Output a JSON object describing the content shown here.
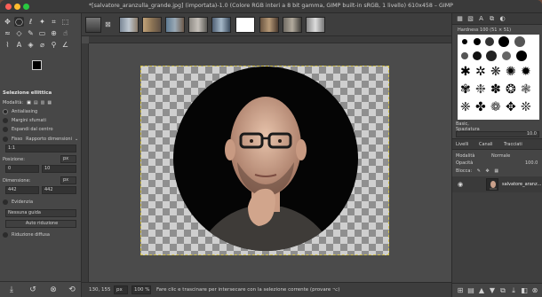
{
  "window": {
    "title": "*[salvatore_aranzulla_grande.jpg] (importata)-1.0 (Colore RGB interi a 8 bit gamma, GIMP built-in sRGB, 1 livello) 610x458 – GIMP"
  },
  "toolbox": {
    "options_title": "Selezione ellittica",
    "mode_label": "Modalità:",
    "antialiasing_label": "Antialiasing",
    "feather_label": "Margini sfumati",
    "expand_label": "Espandi dal centro",
    "fixed_label": "Fisso",
    "fixed_option": "Rapporto dimensioni",
    "ratio_value": "1:1",
    "position_label": "Posizione:",
    "position_unit": "px",
    "position_x": "0",
    "position_y": "10",
    "size_label": "Dimensione:",
    "size_unit": "px",
    "size_w": "442",
    "size_h": "442",
    "highlight_label": "Evidenzia",
    "guides_option": "Nessuna guida",
    "auto_shrink_label": "Auto riduzione",
    "shrink_merged_label": "Riduzione diffusa"
  },
  "statusbar": {
    "coords": "130, 155",
    "unit": "px",
    "zoom": "100 %",
    "message": "Fare clic e trascinare per intersecare con la selezione corrente (provare ⌥)"
  },
  "dock": {
    "brush_label": "Hardness 100 (51 × 51)",
    "basic_label": "Basic,",
    "spacing_label": "Spaziatura",
    "spacing_value": "10.0",
    "tabs": [
      "Livelli",
      "Canali",
      "Tracciati"
    ],
    "mode_label": "Modalità",
    "mode_value": "Normale",
    "opacity_label": "Opacità",
    "opacity_value": "100.0",
    "lock_label": "Blocca:",
    "layer_name": "salvatore_aranz..."
  },
  "colors": {
    "foreground": "#000000",
    "background": "#ffffff",
    "selection_marching_ants": "#d4c34d"
  }
}
